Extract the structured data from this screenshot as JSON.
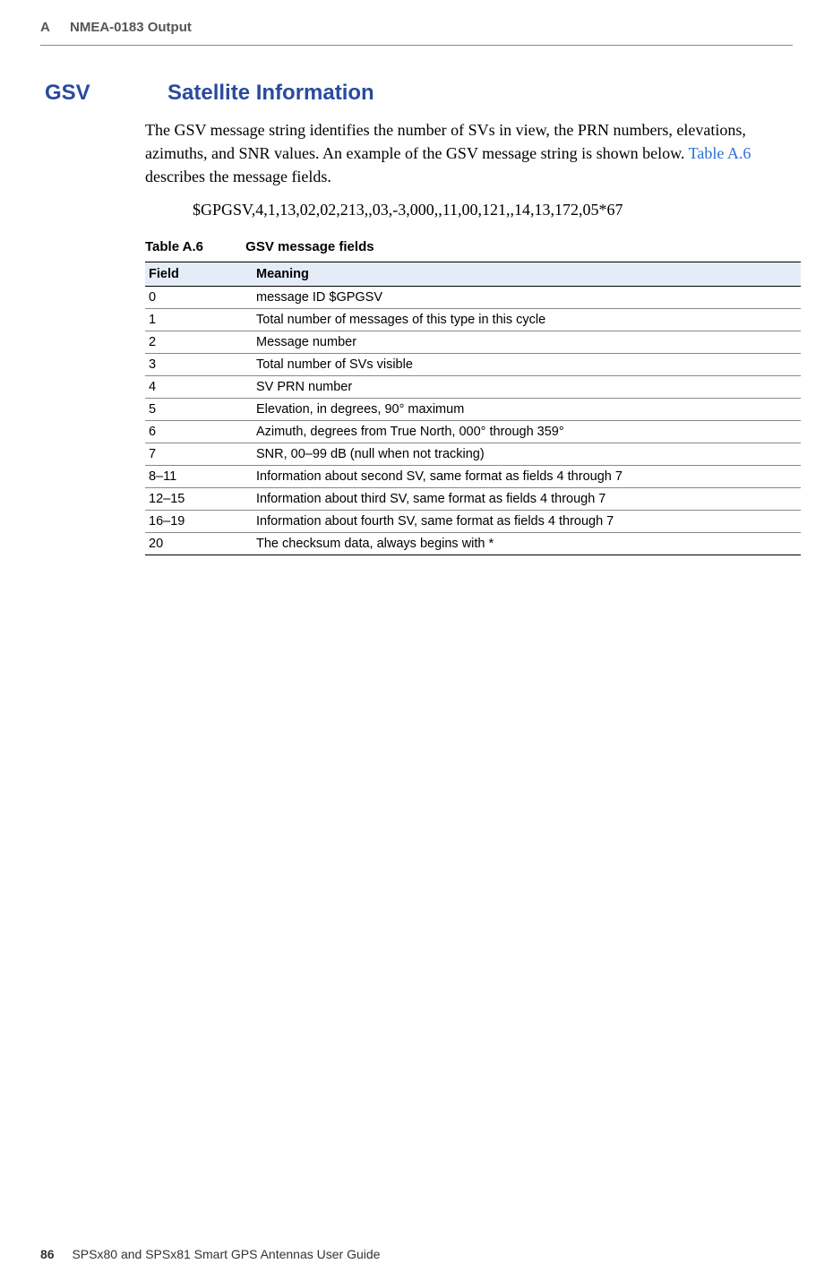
{
  "header": {
    "appendix": "A",
    "title": "NMEA-0183 Output"
  },
  "section": {
    "tag": "GSV",
    "title": "Satellite Information",
    "para_a": "The GSV message string identifies the number of SVs in view, the PRN numbers, elevations, azimuths, and SNR values. An example of the GSV message string is shown below. ",
    "para_link": "Table A.6",
    "para_b": " describes the message fields.",
    "example": "$GPGSV,4,1,13,02,02,213,,03,-3,000,,11,00,121,,14,13,172,05*67"
  },
  "table": {
    "caption_num": "Table A.6",
    "caption_title": "GSV message fields",
    "head_field": "Field",
    "head_meaning": "Meaning",
    "rows": [
      {
        "f": "0",
        "m": "message ID $GPGSV"
      },
      {
        "f": "1",
        "m": "Total number of messages of this type in this cycle"
      },
      {
        "f": "2",
        "m": "Message number"
      },
      {
        "f": "3",
        "m": "Total number of SVs visible"
      },
      {
        "f": "4",
        "m": "SV PRN number"
      },
      {
        "f": "5",
        "m": "Elevation, in degrees, 90° maximum"
      },
      {
        "f": "6",
        "m": "Azimuth, degrees from True North, 000° through 359°"
      },
      {
        "f": "7",
        "m": "SNR, 00–99 dB (null when not tracking)"
      },
      {
        "f": "8–11",
        "m": "Information about second SV, same format as fields 4 through 7"
      },
      {
        "f": "12–15",
        "m": "Information about third SV, same format as fields 4 through 7"
      },
      {
        "f": "16–19",
        "m": "Information about fourth SV, same format as fields 4 through 7"
      },
      {
        "f": "20",
        "m": "The checksum data, always begins with *"
      }
    ]
  },
  "footer": {
    "page": "86",
    "guide": "SPSx80 and SPSx81 Smart GPS Antennas User Guide"
  }
}
